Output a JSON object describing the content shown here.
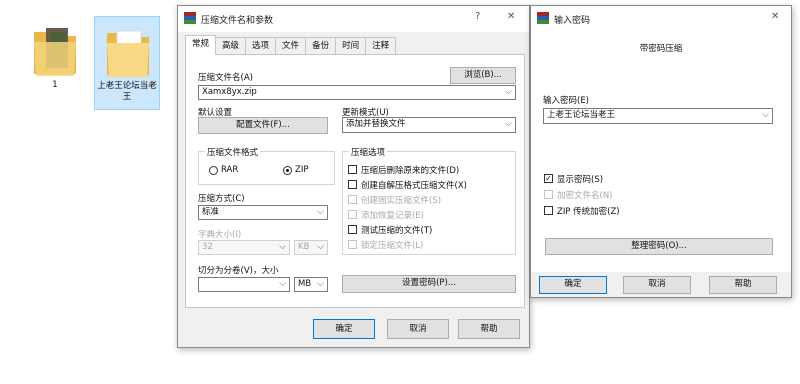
{
  "desktop": {
    "items": [
      {
        "label": "1"
      },
      {
        "label": "上老王论坛当老王"
      }
    ]
  },
  "archive_dialog": {
    "title": "压缩文件名和参数",
    "help_glyph": "?",
    "close_glyph": "✕",
    "tabs": [
      "常规",
      "高级",
      "选项",
      "文件",
      "备份",
      "时间",
      "注释"
    ],
    "archive_name_label": "压缩文件名(A)",
    "browse_label": "浏览(B)...",
    "archive_name_value": "Xamx8yx.zip",
    "default_settings_label": "默认设置",
    "profiles_label": "配置文件(F)...",
    "update_mode_label": "更新模式(U)",
    "update_mode_value": "添加并替换文件",
    "format_group_label": "压缩文件格式",
    "format_rar": "RAR",
    "format_zip": "ZIP",
    "format_selected": "ZIP",
    "options_group_label": "压缩选项",
    "options": [
      {
        "label": "压缩后删除原来的文件(D)",
        "checked": false,
        "disabled": false
      },
      {
        "label": "创建自解压格式压缩文件(X)",
        "checked": false,
        "disabled": false
      },
      {
        "label": "创建固实压缩文件(S)",
        "checked": false,
        "disabled": true
      },
      {
        "label": "添加恢复记录(E)",
        "checked": false,
        "disabled": true
      },
      {
        "label": "测试压缩的文件(T)",
        "checked": false,
        "disabled": false
      },
      {
        "label": "锁定压缩文件(L)",
        "checked": false,
        "disabled": true
      }
    ],
    "method_label": "压缩方式(C)",
    "method_value": "标准",
    "dict_label": "字典大小(I)",
    "dict_value": "32",
    "dict_unit": "KB",
    "split_label": "切分为分卷(V)，大小",
    "split_value": "",
    "split_unit": "MB",
    "set_password_label": "设置密码(P)...",
    "ok_label": "确定",
    "cancel_label": "取消",
    "help_label": "帮助"
  },
  "password_dialog": {
    "title": "输入密码",
    "close_glyph": "✕",
    "subtitle": "带密码压缩",
    "enter_label": "输入密码(E)",
    "password_value": "上老王论坛当老王",
    "show_password_label": "显示密码(S)",
    "show_password_checked": true,
    "encrypt_names_label": "加密文件名(N)",
    "zip_legacy_label": "ZIP 传统加密(Z)",
    "organize_label": "整理密码(O)...",
    "ok_label": "确定",
    "cancel_label": "取消",
    "help_label": "帮助"
  },
  "colors": {
    "selection_bg": "#cce6fb",
    "dialog_bg": "#f0f0f0",
    "accent": "#0078d7"
  }
}
